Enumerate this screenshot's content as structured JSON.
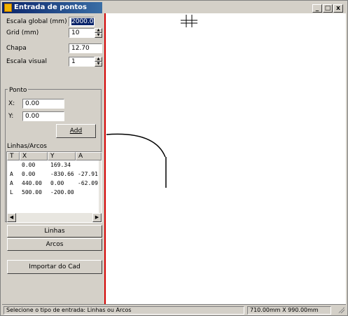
{
  "window": {
    "title": "Entrada de pontos",
    "min_label": "_",
    "max_label": "□",
    "close_label": "x"
  },
  "settings": {
    "global_scale_label": "Escala global (mm)",
    "global_scale_value": "2000.00",
    "grid_label": "Grid (mm)",
    "grid_value": "10",
    "chapa_label": "Chapa",
    "chapa_value": "12.70",
    "visual_scale_label": "Escala visual",
    "visual_scale_value": "1"
  },
  "ponto": {
    "title": "Ponto",
    "x_label": "X:",
    "x_value": "0.00",
    "y_label": "Y:",
    "y_value": "0.00",
    "add_label": "Add"
  },
  "list": {
    "title": "Linhas/Arcos",
    "columns": [
      "T",
      "X",
      "Y",
      "A"
    ],
    "rows": [
      [
        "",
        "0.00",
        "169.34",
        ""
      ],
      [
        "A",
        "0.00",
        "-830.66",
        "-27.91"
      ],
      [
        "A",
        "440.00",
        "0.00",
        "-62.09"
      ],
      [
        "L",
        "500.00",
        "-200.00",
        ""
      ]
    ]
  },
  "buttons": {
    "linhas": "Linhas",
    "arcos": "Arcos",
    "importar": "Importar do Cad"
  },
  "status": {
    "message": "Selecione o tipo de entrada: Linhas ou Arcos",
    "dimensions": "710.00mm X 990.00mm"
  },
  "colors": {
    "title_bar": "#0a246a",
    "divider": "#d40000",
    "panel": "#d4d0c8"
  },
  "icons": [
    "app-icon",
    "minimize-icon",
    "maximize-icon",
    "close-icon",
    "spin-up-icon",
    "spin-down-icon",
    "scroll-left-icon",
    "scroll-right-icon",
    "origin-crosshair-icon",
    "resize-grip-icon"
  ]
}
